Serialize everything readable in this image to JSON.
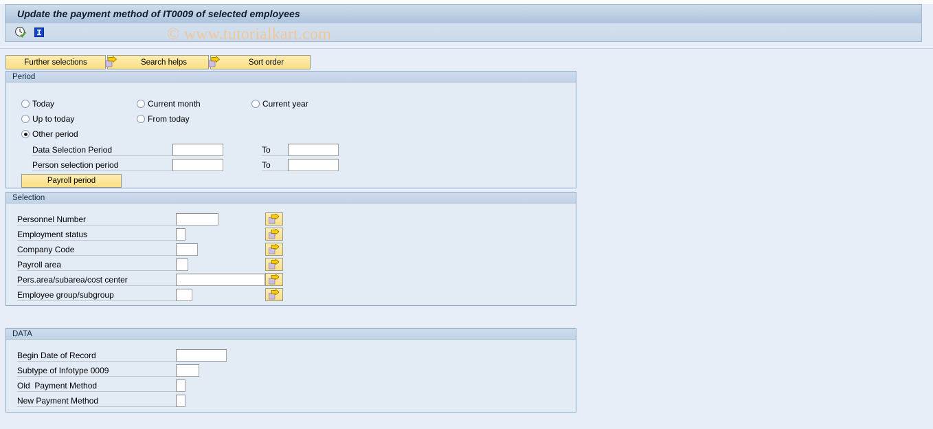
{
  "window": {
    "title": "Update the payment method of IT0009 of selected employees"
  },
  "watermark": {
    "text": "© www.tutorialkart.com"
  },
  "toolbar": {
    "icons": [
      {
        "name": "execute-clock-icon",
        "title": "Execute"
      },
      {
        "name": "information-icon",
        "title": "Information"
      }
    ]
  },
  "button_row": [
    {
      "label": "Further selections",
      "icon": null
    },
    {
      "label": "Search helps",
      "icon": "yellow-arrow-icon"
    },
    {
      "label": "Sort order",
      "icon": "yellow-arrow-icon"
    }
  ],
  "period": {
    "title": "Period",
    "radios": [
      {
        "label": "Today",
        "checked": false
      },
      {
        "label": "Current month",
        "checked": false
      },
      {
        "label": "Current year",
        "checked": false
      },
      {
        "label": "Up to today",
        "checked": false
      },
      {
        "label": "From today",
        "checked": false
      },
      {
        "label": "Other period",
        "checked": true
      }
    ],
    "fields": [
      {
        "label": "Data Selection Period",
        "value": "",
        "to_label": "To",
        "to_value": ""
      },
      {
        "label": "Person selection period",
        "value": "",
        "to_label": "To",
        "to_value": ""
      }
    ],
    "payroll_period_button": "Payroll period"
  },
  "selection": {
    "title": "Selection",
    "rows": [
      {
        "label": "Personnel Number",
        "value": ""
      },
      {
        "label": "Employment status",
        "value": ""
      },
      {
        "label": "Company Code",
        "value": ""
      },
      {
        "label": "Payroll area",
        "value": ""
      },
      {
        "label": "Pers.area/subarea/cost center",
        "value": ""
      },
      {
        "label": "Employee group/subgroup",
        "value": ""
      }
    ],
    "multi_select_icon": "multiple-selection-arrow-icon"
  },
  "data": {
    "title": "DATA",
    "rows": [
      {
        "label": "Begin Date of Record",
        "value": ""
      },
      {
        "label": "Subtype of Infotype 0009",
        "value": ""
      },
      {
        "label": "Old  Payment Method",
        "value": ""
      },
      {
        "label": "New Payment Method",
        "value": ""
      }
    ]
  },
  "colors": {
    "title_bar": "#bccfe4",
    "canvas": "#e8eef7",
    "group_bg": "#e3ebf5",
    "group_border": "#8ba7c7",
    "button_yellow": "#fde79c",
    "watermark": "#f0c79a"
  }
}
